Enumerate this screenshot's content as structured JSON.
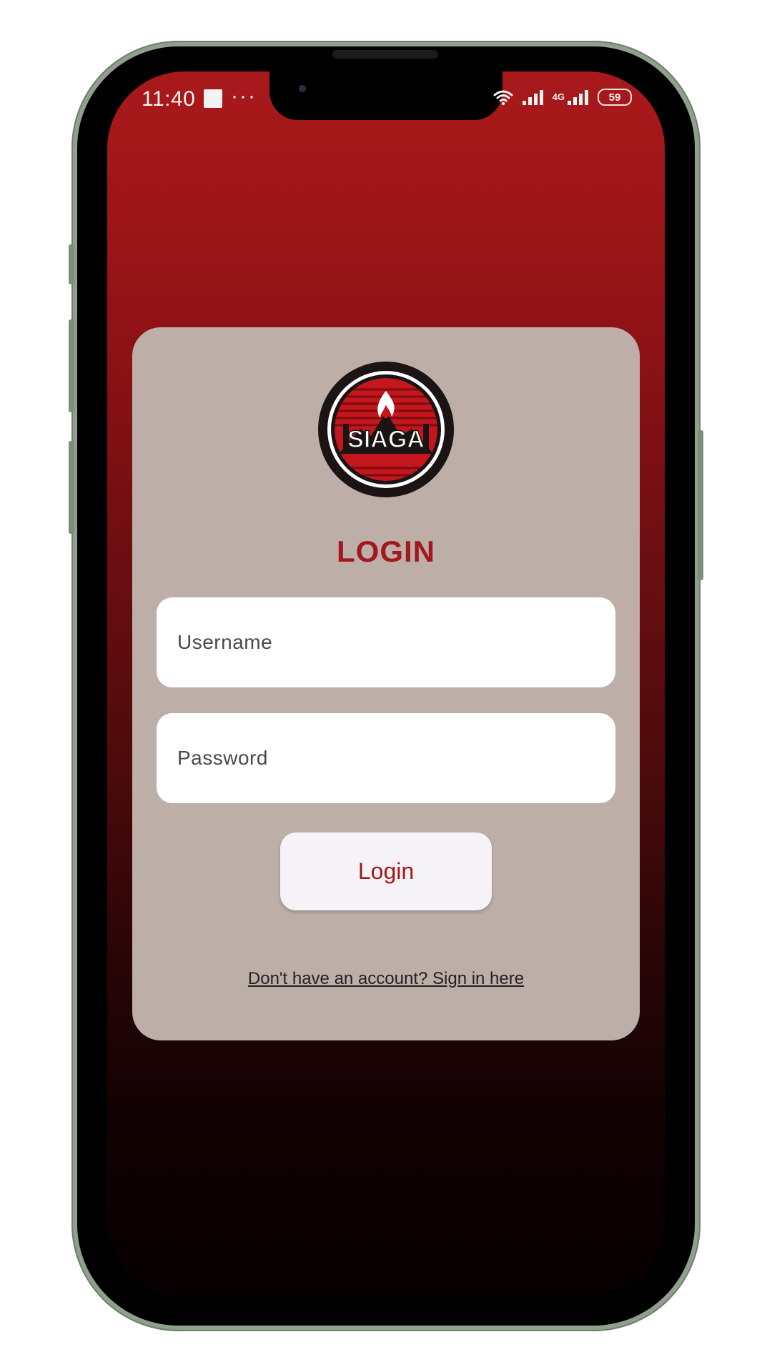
{
  "status_bar": {
    "time": "11:40",
    "more_indicator": "···",
    "network_type": "4G",
    "battery_level": "59"
  },
  "app": {
    "logo_text": "SIAGA",
    "title": "LOGIN",
    "username": {
      "placeholder": "Username",
      "value": ""
    },
    "password": {
      "placeholder": "Password",
      "value": ""
    },
    "login_button_label": "Login",
    "signup_link_text": "Don't have an account? Sign in here"
  },
  "colors": {
    "accent": "#a3181d",
    "card_background": "#bdaea7",
    "gradient_top": "#a8191b",
    "gradient_bottom": "#070000"
  },
  "icons": [
    "wifi-icon",
    "signal-icon",
    "battery-icon",
    "siaga-logo"
  ]
}
